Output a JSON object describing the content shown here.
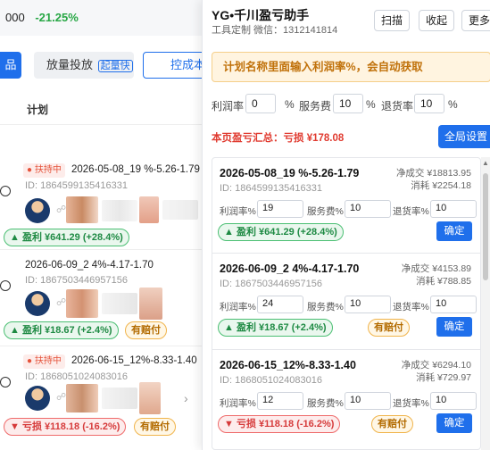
{
  "background": {
    "top_value1": "000",
    "top_value2": "-21.25%",
    "tab_blue": "品",
    "tab_gray": "放量投放",
    "tab_gray_badge": "起量快",
    "tab_outline": "控成本",
    "col_header": "计划",
    "rows": [
      {
        "badge": "扶持中",
        "name": "2026-05-08_19 %-5.26-1.79",
        "id": "ID: 1864599135416331",
        "pill": "▲ 盈利 ¥641.29 (+28.4%)",
        "comp": ""
      },
      {
        "badge": "",
        "name": "2026-06-09_2 4%-4.17-1.70",
        "id": "ID: 1867503446957156",
        "pill": "▲ 盈利 ¥18.67 (+2.4%)",
        "comp": "有赔付"
      },
      {
        "badge": "扶持中",
        "name": "2026-06-15_12%-8.33-1.40",
        "id": "ID: 1868051024083016",
        "pill": "▼ 亏损 ¥118.18 (-16.2%)",
        "comp": "有赔付"
      }
    ]
  },
  "panel": {
    "title": "YG•千川盈亏助手",
    "subtitle": "工具定制 微信：1312141814",
    "buttons": {
      "capture": "扫描",
      "collapse": "收起",
      "more": "更多"
    },
    "tip": "计划名称里面输入利润率%，会自动获取",
    "rates": {
      "profit_label": "利润率",
      "profit_value": "0",
      "service_label": "服务费",
      "service_value": "10",
      "return_label": "退货率",
      "return_value": "10",
      "unit": "%"
    },
    "summary": "本页盈亏汇总：亏损 ¥178.08",
    "global_button": "全局设置",
    "cards": [
      {
        "name": "2026-05-08_19 %-5.26-1.79",
        "id": "ID: 1864599135416331",
        "net": "净成交 ¥18813.95",
        "cost": "消耗 ¥2254.18",
        "profit_label": "利润率%",
        "profit_value": "19",
        "service_label": "服务费%",
        "service_value": "10",
        "return_label": "退货率%",
        "return_value": "10",
        "pill": "▲ 盈利 ¥641.29 (+28.4%)",
        "pill_kind": "profit",
        "comp": "",
        "ok": "确定"
      },
      {
        "name": "2026-06-09_2 4%-4.17-1.70",
        "id": "ID: 1867503446957156",
        "net": "净成交 ¥4153.89",
        "cost": "消耗 ¥788.85",
        "profit_label": "利润率%",
        "profit_value": "24",
        "service_label": "服务费%",
        "service_value": "10",
        "return_label": "退货率%",
        "return_value": "10",
        "pill": "▲ 盈利 ¥18.67 (+2.4%)",
        "pill_kind": "profit",
        "comp": "有赔付",
        "ok": "确定"
      },
      {
        "name": "2026-06-15_12%-8.33-1.40",
        "id": "ID: 1868051024083016",
        "net": "净成交 ¥6294.10",
        "cost": "消耗 ¥729.97",
        "profit_label": "利润率%",
        "profit_value": "12",
        "service_label": "服务费%",
        "service_value": "10",
        "return_label": "退货率%",
        "return_value": "10",
        "pill": "▼ 亏损 ¥118.18 (-16.2%)",
        "pill_kind": "loss",
        "comp": "有赔付",
        "ok": "确定"
      }
    ]
  }
}
